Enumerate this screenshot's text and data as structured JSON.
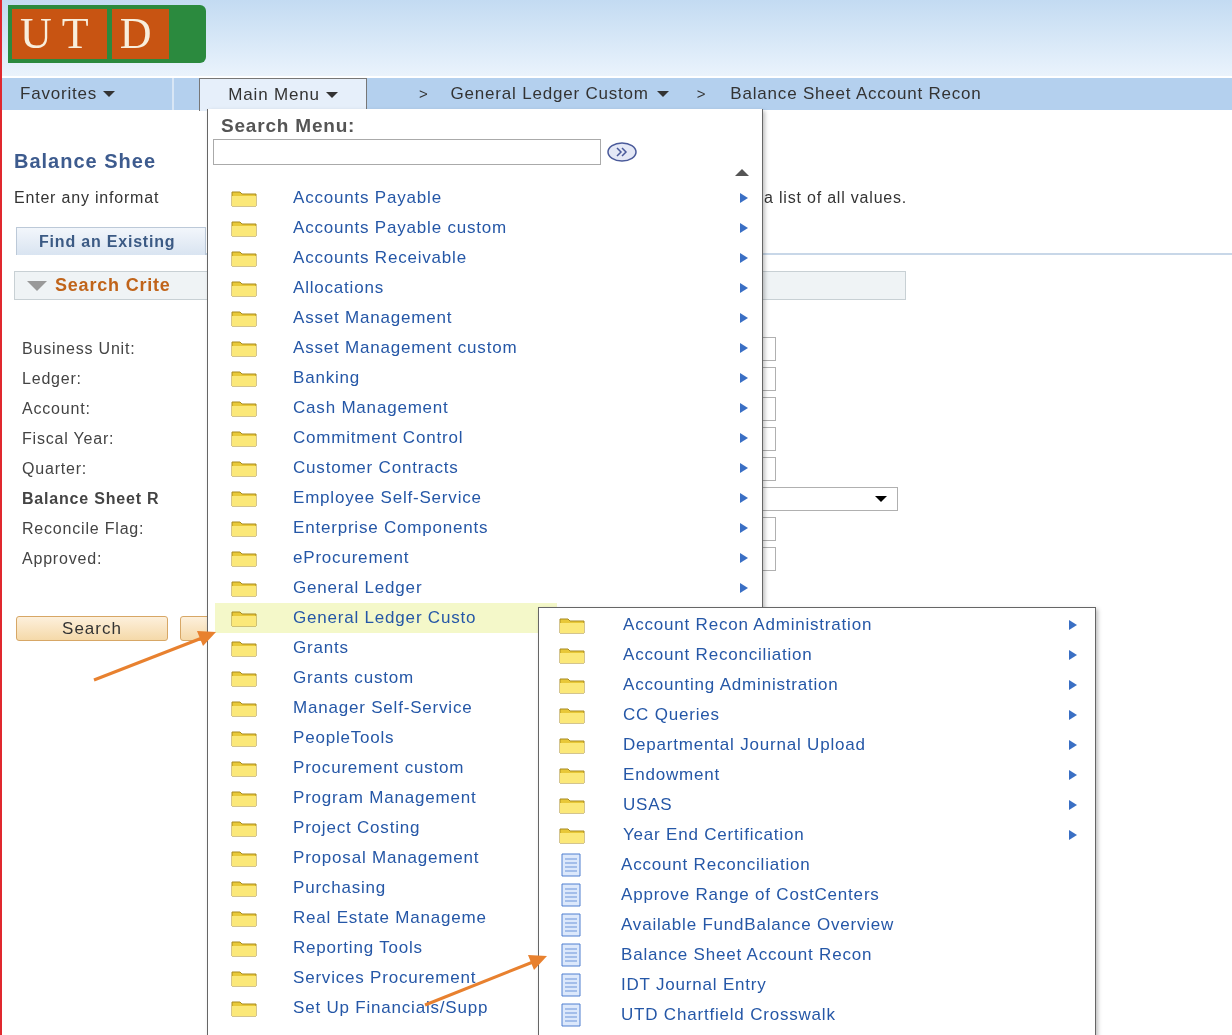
{
  "header": {
    "logo": [
      "UT",
      "D"
    ]
  },
  "nav": {
    "favorites": "Favorites",
    "main_menu": "Main Menu",
    "breadcrumbs": [
      {
        "separator": ">",
        "label": "General Ledger Custom",
        "dropdown": true
      },
      {
        "separator": ">",
        "label": "Balance Sheet Account Recon",
        "dropdown": false
      }
    ]
  },
  "page": {
    "title": "Balance Shee",
    "instructions": [
      "Enter any informat",
      "a list of all values."
    ],
    "tab": "Find an Existing",
    "section": {
      "label": "Search Crite",
      "expanded": true
    },
    "fields": [
      {
        "label": "Business Unit:",
        "kind": "text",
        "emphasis": false
      },
      {
        "label": "Ledger:",
        "kind": "text",
        "emphasis": false
      },
      {
        "label": "Account:",
        "kind": "text",
        "emphasis": false
      },
      {
        "label": "Fiscal Year:",
        "kind": "text",
        "emphasis": false
      },
      {
        "label": "Quarter:",
        "kind": "text",
        "emphasis": false
      },
      {
        "label": "Balance Sheet R",
        "kind": "select",
        "emphasis": true
      },
      {
        "label": "Reconcile Flag:",
        "kind": "text",
        "emphasis": false
      },
      {
        "label": "Approved:",
        "kind": "text",
        "emphasis": false
      }
    ],
    "search_button": "Search"
  },
  "menu": {
    "search_label": "Search Menu:",
    "items": [
      {
        "label": "Accounts Payable",
        "kind": "folder",
        "arrow": true,
        "selected": false
      },
      {
        "label": "Accounts Payable custom",
        "kind": "folder",
        "arrow": true,
        "selected": false
      },
      {
        "label": "Accounts Receivable",
        "kind": "folder",
        "arrow": true,
        "selected": false
      },
      {
        "label": "Allocations",
        "kind": "folder",
        "arrow": true,
        "selected": false
      },
      {
        "label": "Asset Management",
        "kind": "folder",
        "arrow": true,
        "selected": false
      },
      {
        "label": "Asset Management custom",
        "kind": "folder",
        "arrow": true,
        "selected": false
      },
      {
        "label": "Banking",
        "kind": "folder",
        "arrow": true,
        "selected": false
      },
      {
        "label": "Cash Management",
        "kind": "folder",
        "arrow": true,
        "selected": false
      },
      {
        "label": "Commitment Control",
        "kind": "folder",
        "arrow": true,
        "selected": false
      },
      {
        "label": "Customer Contracts",
        "kind": "folder",
        "arrow": true,
        "selected": false
      },
      {
        "label": "Employee Self-Service",
        "kind": "folder",
        "arrow": true,
        "selected": false
      },
      {
        "label": "Enterprise Components",
        "kind": "folder",
        "arrow": true,
        "selected": false
      },
      {
        "label": "eProcurement",
        "kind": "folder",
        "arrow": true,
        "selected": false
      },
      {
        "label": "General Ledger",
        "kind": "folder",
        "arrow": true,
        "selected": false
      },
      {
        "label": "General Ledger Custo",
        "kind": "folder",
        "arrow": false,
        "selected": true
      },
      {
        "label": "Grants",
        "kind": "folder",
        "arrow": false,
        "selected": false
      },
      {
        "label": "Grants custom",
        "kind": "folder",
        "arrow": false,
        "selected": false
      },
      {
        "label": "Manager Self-Service",
        "kind": "folder",
        "arrow": false,
        "selected": false
      },
      {
        "label": "PeopleTools",
        "kind": "folder",
        "arrow": false,
        "selected": false
      },
      {
        "label": "Procurement custom",
        "kind": "folder",
        "arrow": false,
        "selected": false
      },
      {
        "label": "Program Management",
        "kind": "folder",
        "arrow": false,
        "selected": false
      },
      {
        "label": "Project Costing",
        "kind": "folder",
        "arrow": false,
        "selected": false
      },
      {
        "label": "Proposal Management",
        "kind": "folder",
        "arrow": false,
        "selected": false
      },
      {
        "label": "Purchasing",
        "kind": "folder",
        "arrow": false,
        "selected": false
      },
      {
        "label": "Real Estate Manageme",
        "kind": "folder",
        "arrow": false,
        "selected": false
      },
      {
        "label": "Reporting Tools",
        "kind": "folder",
        "arrow": false,
        "selected": false
      },
      {
        "label": "Services Procurement",
        "kind": "folder",
        "arrow": false,
        "selected": false
      },
      {
        "label": "Set Up Financials/Supp",
        "kind": "folder",
        "arrow": false,
        "selected": false
      }
    ]
  },
  "submenu": {
    "items": [
      {
        "label": "Account Recon Administration",
        "kind": "folder",
        "arrow": true
      },
      {
        "label": "Account Reconciliation",
        "kind": "folder",
        "arrow": true
      },
      {
        "label": "Accounting Administration",
        "kind": "folder",
        "arrow": true
      },
      {
        "label": "CC Queries",
        "kind": "folder",
        "arrow": true
      },
      {
        "label": "Departmental Journal Upload",
        "kind": "folder",
        "arrow": true
      },
      {
        "label": "Endowment",
        "kind": "folder",
        "arrow": true
      },
      {
        "label": "USAS",
        "kind": "folder",
        "arrow": true
      },
      {
        "label": "Year End Certification",
        "kind": "folder",
        "arrow": true
      },
      {
        "label": "Account Reconciliation",
        "kind": "page",
        "arrow": false
      },
      {
        "label": "Approve Range of CostCenters",
        "kind": "page",
        "arrow": false
      },
      {
        "label": "Available FundBalance Overview",
        "kind": "page",
        "arrow": false
      },
      {
        "label": "Balance Sheet Account Recon",
        "kind": "page",
        "arrow": false
      },
      {
        "label": "IDT Journal Entry",
        "kind": "page",
        "arrow": false
      },
      {
        "label": "UTD Chartfield Crosswalk",
        "kind": "page",
        "arrow": false
      }
    ]
  }
}
